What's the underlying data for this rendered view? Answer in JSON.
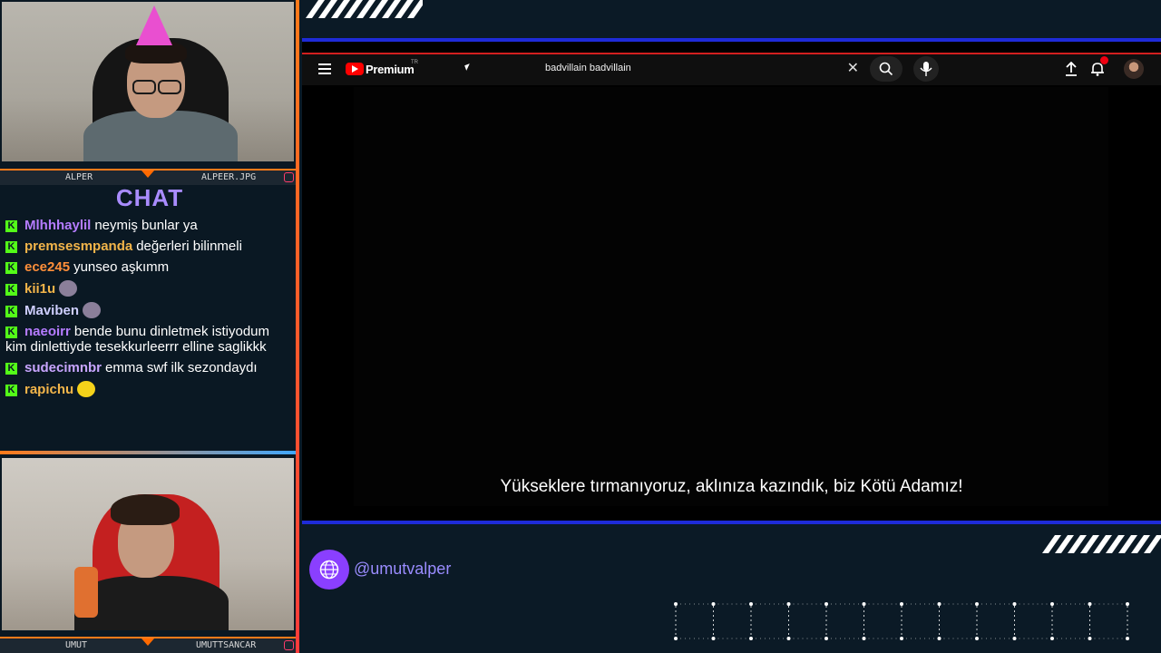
{
  "cams": {
    "top": {
      "left_name": "ALPER",
      "right_name": "ALPEER.JPG"
    },
    "bottom": {
      "left_name": "UMUT",
      "right_name": "UMUTTSANCAR"
    }
  },
  "chat": {
    "title": "CHAT",
    "messages": [
      {
        "user": "Mlhhhaylil",
        "text": "neymiş bunlar ya",
        "color": "#b57cff"
      },
      {
        "user": "premsesmpanda",
        "text": "değerleri bilinmeli",
        "color": "#f3b54a"
      },
      {
        "user": "ece245",
        "text": "yunseo aşkımm",
        "color": "#ff8f3a"
      },
      {
        "user": "kii1u",
        "text": "",
        "color": "#f3b54a",
        "emote": "person-emote"
      },
      {
        "user": "Maviben",
        "text": "",
        "color": "#cfcfff",
        "emote": "person-emote"
      },
      {
        "user": "naeoirr",
        "text": "bende bunu dinletmek istiyodum kim dinlettiyde tesekkurleerrr elline saglikkk",
        "color": "#b57cff"
      },
      {
        "user": "sudecimnbr",
        "text": "emma swf ilk sezondaydı",
        "color": "#c8a5ff"
      },
      {
        "user": "rapichu",
        "text": "",
        "color": "#f3b54a",
        "emote": "pikachu-emote"
      }
    ]
  },
  "youtube": {
    "brand": "Premium",
    "region": "TR",
    "search_query": "badvillain badvillain",
    "notification_count": "1"
  },
  "video": {
    "subtitle": "Yükseklere tırmanıyoruz, aklınıza kazındık, biz Kötü Adamız!"
  },
  "footer": {
    "handle": "@umutvalper"
  },
  "colors": {
    "accent_purple": "#8a3fff",
    "kick_green": "#53fc18",
    "youtube_red": "#ff0000",
    "frame_blue": "#1e2bd8"
  }
}
